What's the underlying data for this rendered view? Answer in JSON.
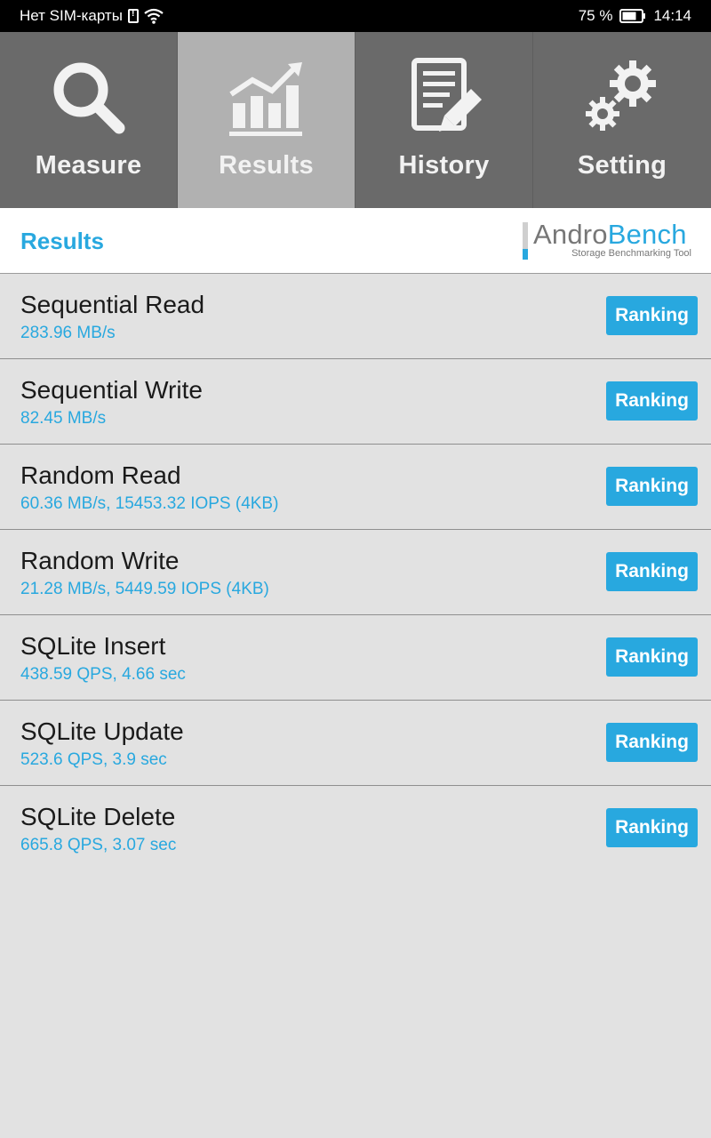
{
  "status_bar": {
    "carrier": "Нет SIM-карты",
    "battery_percent": "75 %",
    "time": "14:14",
    "icons": [
      "sim-alert-icon",
      "wifi-icon",
      "battery-icon"
    ]
  },
  "tabs": [
    {
      "label": "Measure",
      "icon": "magnifier-icon",
      "active": false
    },
    {
      "label": "Results",
      "icon": "bar-chart-icon",
      "active": true
    },
    {
      "label": "History",
      "icon": "document-edit-icon",
      "active": false
    },
    {
      "label": "Setting",
      "icon": "gears-icon",
      "active": false
    }
  ],
  "header": {
    "title": "Results",
    "logo": {
      "andro": "Andro",
      "bench": "Bench",
      "tagline": "Storage Benchmarking Tool"
    }
  },
  "results": [
    {
      "title": "Sequential Read",
      "value": "283.96 MB/s",
      "button": "Ranking"
    },
    {
      "title": "Sequential Write",
      "value": "82.45 MB/s",
      "button": "Ranking"
    },
    {
      "title": "Random Read",
      "value": "60.36 MB/s, 15453.32 IOPS (4KB)",
      "button": "Ranking"
    },
    {
      "title": "Random Write",
      "value": "21.28 MB/s, 5449.59 IOPS (4KB)",
      "button": "Ranking"
    },
    {
      "title": "SQLite Insert",
      "value": "438.59 QPS, 4.66 sec",
      "button": "Ranking"
    },
    {
      "title": "SQLite Update",
      "value": "523.6 QPS, 3.9 sec",
      "button": "Ranking"
    },
    {
      "title": "SQLite Delete",
      "value": "665.8 QPS, 3.07 sec",
      "button": "Ranking"
    }
  ],
  "colors": {
    "accent": "#28a8df",
    "tab_bg": "#6a6a6a",
    "tab_active": "#b1b1b1",
    "list_bg": "#e2e2e2"
  }
}
